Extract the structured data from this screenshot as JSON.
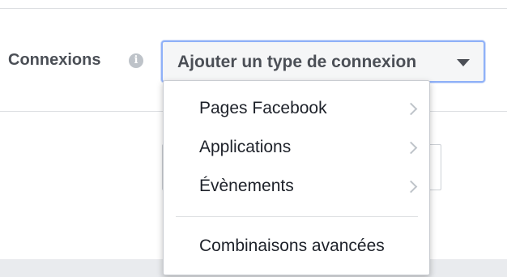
{
  "field": {
    "label": "Connexions",
    "info_icon": "i"
  },
  "select": {
    "value": "Ajouter un type de connexion"
  },
  "menu": {
    "items": [
      {
        "label": "Pages Facebook",
        "has_submenu": true
      },
      {
        "label": "Applications",
        "has_submenu": true
      },
      {
        "label": "Évènements",
        "has_submenu": true
      }
    ],
    "footer_item": {
      "label": "Combinaisons avancées"
    }
  },
  "colors": {
    "focus_border": "#8fb1f8",
    "label_text": "#4b4f56",
    "menu_text": "#1d2129",
    "chevron": "#bec3c9"
  }
}
